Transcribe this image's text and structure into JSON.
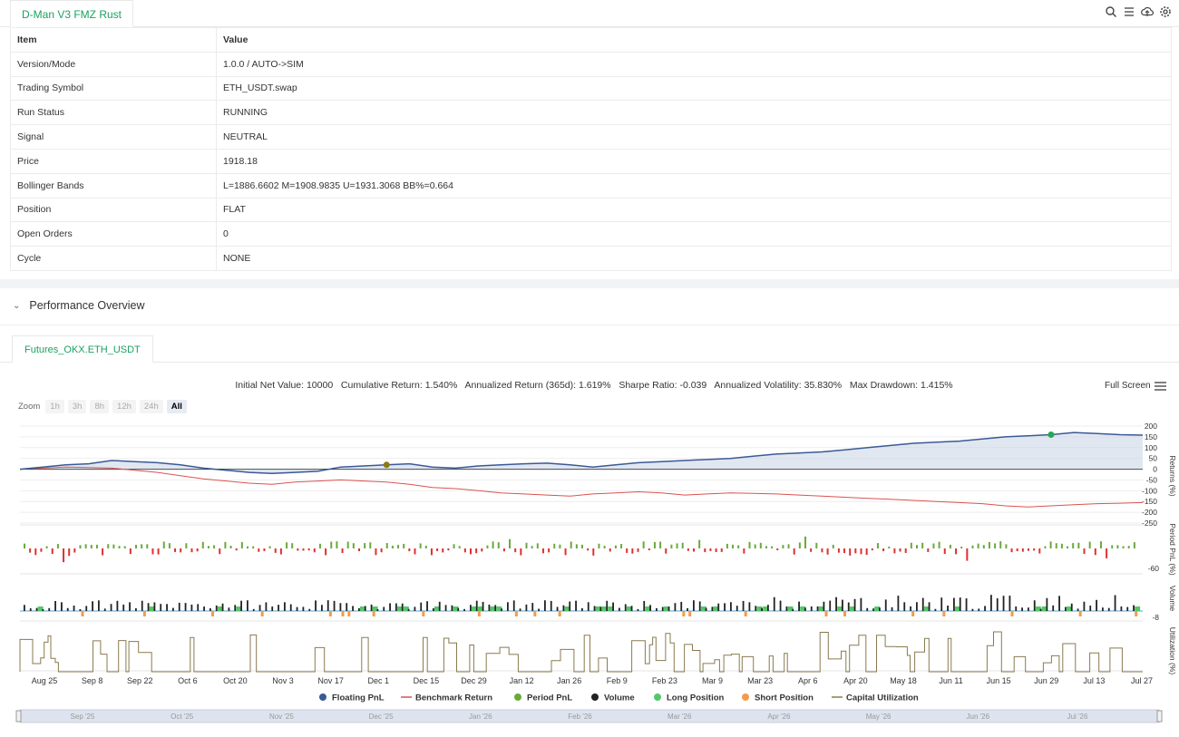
{
  "app": {
    "tab_title": "D-Man V3 FMZ Rust",
    "icons": [
      "search-icon",
      "list-icon",
      "cloud-upload-icon",
      "gear-icon"
    ]
  },
  "info_table": {
    "header": {
      "item": "Item",
      "value": "Value"
    },
    "rows": [
      {
        "item": "Version/Mode",
        "value": "1.0.0 / AUTO->SIM"
      },
      {
        "item": "Trading Symbol",
        "value": "ETH_USDT.swap"
      },
      {
        "item": "Run Status",
        "value": "RUNNING"
      },
      {
        "item": "Signal",
        "value": "NEUTRAL"
      },
      {
        "item": "Price",
        "value": "1918.18"
      },
      {
        "item": "Bollinger Bands",
        "value": "L=1886.6602 M=1908.9835 U=1931.3068 BB%=0.664"
      },
      {
        "item": "Position",
        "value": "FLAT"
      },
      {
        "item": "Open Orders",
        "value": "0"
      },
      {
        "item": "Cycle",
        "value": "NONE"
      }
    ]
  },
  "performance": {
    "section_title": "Performance Overview",
    "tab_label": "Futures_OKX.ETH_USDT",
    "stats_line": "Initial Net Value: 10000   Cumulative Return: 1.540%   Annualized Return (365d): 1.619%   Sharpe Ratio: -0.039   Annualized Volatility: 35.830%   Max Drawdown: 1.415%",
    "full_screen_label": "Full Screen",
    "zoom": {
      "label": "Zoom",
      "buttons": [
        "1h",
        "3h",
        "8h",
        "12h",
        "24h",
        "All"
      ],
      "active": "All"
    }
  },
  "chart_data": {
    "type": "line",
    "x_tick_labels": [
      "Aug 25",
      "Sep 8",
      "Sep 22",
      "Oct 6",
      "Oct 20",
      "Nov 3",
      "Nov 17",
      "Dec 1",
      "Dec 15",
      "Dec 29",
      "Jan 12",
      "Jan 26",
      "Feb 9",
      "Feb 23",
      "Mar 9",
      "Mar 23",
      "Apr 6",
      "Apr 20",
      "May 18",
      "Jun 11",
      "Jun 15",
      "Jun 29",
      "Jul 13",
      "Jul 27"
    ],
    "navigator_labels": [
      "Sep '25",
      "Oct '25",
      "Nov '25",
      "Dec '25",
      "Jan '26",
      "Feb '26",
      "Mar '26",
      "Apr '26",
      "May '26",
      "Jun '26",
      "Jul '26"
    ],
    "panels": [
      {
        "ylabel": "Returns (%)",
        "ticks": [
          200,
          150,
          100,
          50,
          0,
          -50,
          -100,
          -150,
          -200,
          -250
        ],
        "ylim": [
          -250,
          200
        ]
      },
      {
        "ylabel": "Period PnL (%)",
        "ticks": [
          -60
        ]
      },
      {
        "ylabel": "Volume",
        "ticks": [
          -8
        ]
      },
      {
        "ylabel": "Utilization (%)",
        "ticks": []
      }
    ],
    "legend": [
      "Floating PnL",
      "Benchmark Return",
      "Period PnL",
      "Volume",
      "Long Position",
      "Short Position",
      "Capital Utilization"
    ],
    "colors": {
      "floating_pnl": "#3a5a96",
      "benchmark": "#d9534f",
      "period_pnl_pos": "#6aaa3c",
      "period_pnl_neg": "#e03030",
      "volume": "#222222",
      "long": "#55c76a",
      "short": "#f59a4a",
      "utilization": "#8b7a50"
    },
    "series": [
      {
        "name": "Floating PnL",
        "values": [
          0,
          10,
          20,
          25,
          40,
          35,
          30,
          20,
          5,
          -5,
          -15,
          -20,
          -15,
          -10,
          10,
          15,
          20,
          25,
          10,
          5,
          15,
          20,
          25,
          28,
          20,
          10,
          20,
          30,
          35,
          40,
          45,
          50,
          60,
          70,
          75,
          80,
          90,
          100,
          110,
          120,
          125,
          130,
          140,
          150,
          155,
          160,
          170,
          165,
          160,
          158
        ]
      },
      {
        "name": "Benchmark Return",
        "values": [
          0,
          5,
          10,
          8,
          5,
          -5,
          -15,
          -30,
          -45,
          -55,
          -65,
          -70,
          -60,
          -55,
          -50,
          -55,
          -60,
          -70,
          -85,
          -90,
          -100,
          -110,
          -115,
          -120,
          -125,
          -115,
          -110,
          -105,
          -110,
          -120,
          -115,
          -110,
          -112,
          -115,
          -120,
          -125,
          -130,
          -135,
          -140,
          -145,
          -150,
          -155,
          -160,
          -170,
          -175,
          -170,
          -165,
          -160,
          -158,
          -155
        ]
      }
    ],
    "markers": [
      {
        "series": "Floating PnL",
        "type": "long",
        "index": 45
      },
      {
        "series": "Floating PnL",
        "type": "short",
        "index": 16
      }
    ]
  }
}
